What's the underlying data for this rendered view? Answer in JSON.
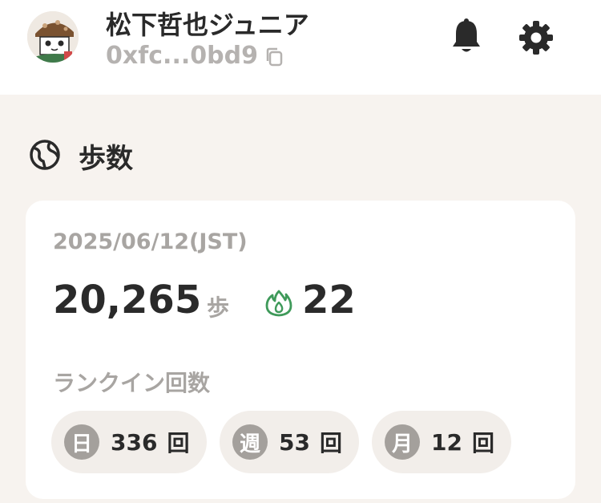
{
  "header": {
    "user_name": "松下哲也ジュニア",
    "wallet_address": "0xfc...0bd9",
    "icons": [
      "avatar",
      "copy-icon",
      "bell-icon",
      "gear-icon"
    ]
  },
  "section": {
    "title": "歩数",
    "icon": "globe-icon"
  },
  "card": {
    "date": "2025/06/12(JST)",
    "steps": "20,265",
    "steps_unit": "歩",
    "streak_icon": "flame-icon",
    "streak": "22",
    "rankin_label": "ランクイン回数",
    "chips": [
      {
        "badge": "日",
        "count": "336",
        "unit": "回"
      },
      {
        "badge": "週",
        "count": "53",
        "unit": "回"
      },
      {
        "badge": "月",
        "count": "12",
        "unit": "回"
      }
    ]
  },
  "colors": {
    "background": "#f7f3ef",
    "card": "#ffffff",
    "text": "#2a2a2a",
    "muted": "#a8a5a2",
    "accent_green": "#3f9a5a",
    "chip_bg": "#f2eeea",
    "badge_bg": "#a4a09c"
  }
}
